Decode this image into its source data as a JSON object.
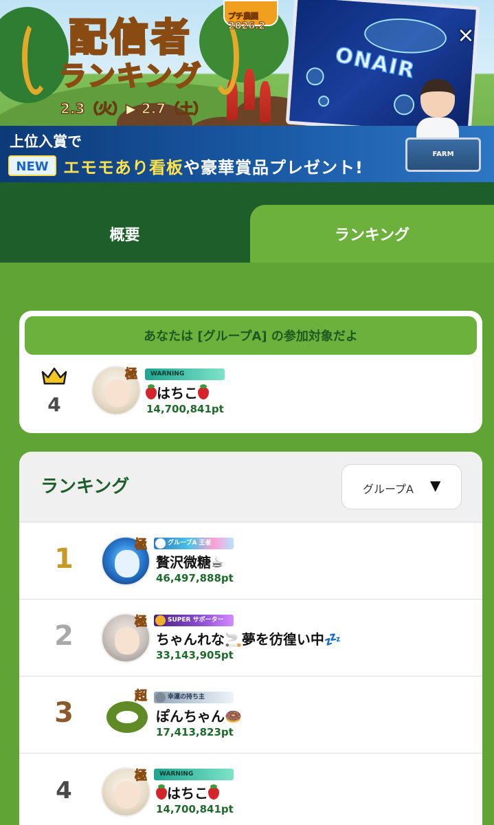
{
  "banner": {
    "title_line1": "配信者",
    "title_line2": "ランキング",
    "dates": "2.3（火）▶ 2.7（土）",
    "farm_logo": "プチ農園",
    "farm_year": "2026.2",
    "promo_line1": "上位入賞で",
    "new_badge": "NEW",
    "promo_line2_a": "エモモあり看板",
    "promo_line2_b": "や豪華賞品プレゼント!",
    "onair": "ONAIR",
    "sign": "FARM",
    "close": "×"
  },
  "tabs": {
    "overview": "概要",
    "ranking": "ランキング",
    "active": "ranking"
  },
  "status": {
    "header": "あなたは [グループA] の参加対象だよ",
    "rank": "4",
    "grade": "極",
    "plate": "WARNING",
    "name": "はちこ",
    "points": "14,700,841pt"
  },
  "ranking": {
    "title": "ランキング",
    "group_selected": "グループA",
    "group_arrow": "▼",
    "rows": [
      {
        "rank": "1",
        "rank_color": "#c59a28",
        "grade": "極",
        "plate": "グループA 王者",
        "name": "贅沢微糖☕",
        "points": "46,497,888pt"
      },
      {
        "rank": "2",
        "rank_color": "#a9a9a9",
        "grade": "極",
        "plate": "SUPER サポーター",
        "name": "ちゃんれな🚬夢を彷徨い中💤",
        "points": "33,143,905pt"
      },
      {
        "rank": "3",
        "rank_color": "#8b5a2b",
        "grade": "超",
        "plate": "幸運の持ち主",
        "name": "ぽんちゃん🍩",
        "points": "17,413,823pt"
      },
      {
        "rank": "4",
        "rank_color": "#4a4a4a",
        "grade": "極",
        "plate": "WARNING",
        "name": "はちこ",
        "points": "14,700,841pt"
      }
    ]
  },
  "colors": {
    "page_bg": "#5fa435",
    "tab_dark": "#1d5e2a",
    "tab_active": "#6cb13c",
    "accent_text": "#1d6a2a",
    "gold_crown": "#f4c623"
  }
}
